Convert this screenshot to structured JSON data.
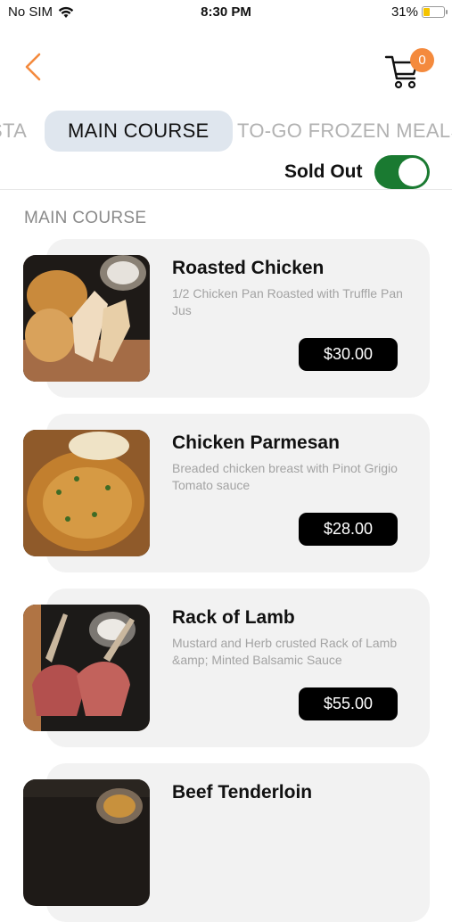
{
  "status_bar": {
    "carrier": "No SIM",
    "time": "8:30 PM",
    "battery": "31%",
    "battery_level": 0.31,
    "icons": [
      "wifi-icon",
      "battery-icon"
    ]
  },
  "header": {
    "back_icon": "chevron-left-icon",
    "cart_icon": "cart-icon",
    "cart_count": "0",
    "accent_color": "#f48a3d"
  },
  "tabs": [
    {
      "label": "STA",
      "active": false
    },
    {
      "label": "MAIN COURSE",
      "active": true
    },
    {
      "label": "TO-GO FROZEN MEALS",
      "active": false
    }
  ],
  "sold_out": {
    "label": "Sold Out",
    "enabled": true,
    "color": "#1a7a31"
  },
  "section": {
    "title": "MAIN COURSE"
  },
  "items": [
    {
      "name": "Roasted Chicken",
      "description": "1/2 Chicken Pan Roasted with Truffle Pan Jus",
      "price": "$30.00"
    },
    {
      "name": "Chicken Parmesan",
      "description": "Breaded chicken breast with Pinot Grigio Tomato sauce",
      "price": "$28.00"
    },
    {
      "name": "Rack of Lamb",
      "description": "Mustard and Herb crusted Rack of Lamb &amp; Minted Balsamic Sauce",
      "price": "$55.00"
    },
    {
      "name": "Beef Tenderloin",
      "description": "",
      "price": ""
    }
  ]
}
